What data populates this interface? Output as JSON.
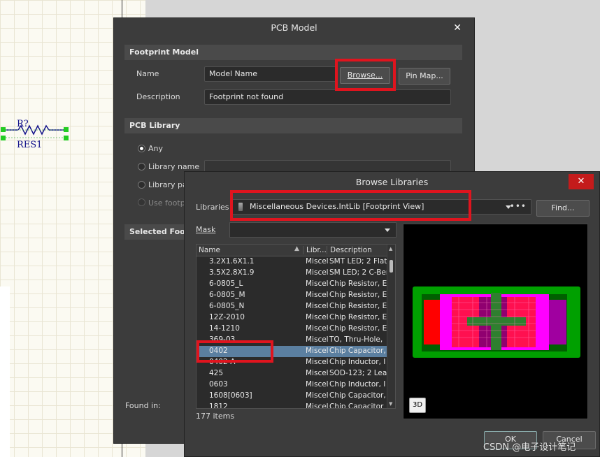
{
  "schematic": {
    "designator": "R?",
    "comment": "RES1"
  },
  "pcb_model": {
    "title": "PCB Model",
    "close_icon": "close-icon",
    "footprint_section": "Footprint Model",
    "name_label": "Name",
    "name_value": "Model Name",
    "browse_label": "Browse...",
    "pinmap_label": "Pin Map...",
    "description_label": "Description",
    "description_value": "Footprint not found",
    "pcb_library_section": "PCB Library",
    "radio_any": "Any",
    "radio_library_name": "Library name",
    "radio_library_path": "Library pa",
    "radio_use_footprint": "Use footp",
    "selected_footprint_section": "Selected Footp",
    "found_in_label": "Found in:"
  },
  "browse": {
    "title": "Browse Libraries",
    "libraries_label": "Libraries",
    "libraries_value": "Miscellaneous Devices.IntLib [Footprint View]",
    "more_icon": "ellipsis-icon",
    "find_label": "Find...",
    "mask_label": "Mask",
    "mask_value": "",
    "columns": [
      "Name",
      "Libr...",
      "Description"
    ],
    "rows": [
      {
        "name": "3.2X1.6X1.1",
        "lib": "Miscel",
        "desc": "SMT LED; 2 Flat"
      },
      {
        "name": "3.5X2.8X1.9",
        "lib": "Miscel",
        "desc": "SM LED; 2 C-Ber"
      },
      {
        "name": "6-0805_L",
        "lib": "Miscel",
        "desc": "Chip Resistor, E"
      },
      {
        "name": "6-0805_M",
        "lib": "Miscel",
        "desc": "Chip Resistor, E"
      },
      {
        "name": "6-0805_N",
        "lib": "Miscel",
        "desc": "Chip Resistor, E"
      },
      {
        "name": "12Z-2010",
        "lib": "Miscel",
        "desc": "Chip Resistor, E"
      },
      {
        "name": "14-1210",
        "lib": "Miscel",
        "desc": "Chip Resistor, E"
      },
      {
        "name": "369-03",
        "lib": "Miscel",
        "desc": "TO, Thru-Hole,"
      },
      {
        "name": "0402",
        "lib": "Miscel",
        "desc": "Chip Capacitor,"
      },
      {
        "name": "0402-A",
        "lib": "Miscel",
        "desc": "Chip Inductor, I"
      },
      {
        "name": "425",
        "lib": "Miscel",
        "desc": "SOD-123; 2 Lea"
      },
      {
        "name": "0603",
        "lib": "Miscel",
        "desc": "Chip Inductor, I"
      },
      {
        "name": "1608[0603]",
        "lib": "Miscel",
        "desc": "Chip Capacitor,"
      },
      {
        "name": "1812",
        "lib": "Miscel",
        "desc": "Chip Capacitor"
      }
    ],
    "selected_row": 8,
    "items_count": "177 items",
    "view3d_label": "3D",
    "ok_label": "OK",
    "cancel_label": "Cancel"
  },
  "watermark": "CSDN @电子设计笔记",
  "colors": {
    "highlight": "#e0141e",
    "selection": "#5b7fa0",
    "dialog_bg": "#3c3c3c",
    "close_red": "#c41b1b",
    "pad_red": "#ff0000",
    "overlay_magenta": "#ff00ff",
    "board_green": "#00a000",
    "body_green": "#2f7f2f"
  }
}
